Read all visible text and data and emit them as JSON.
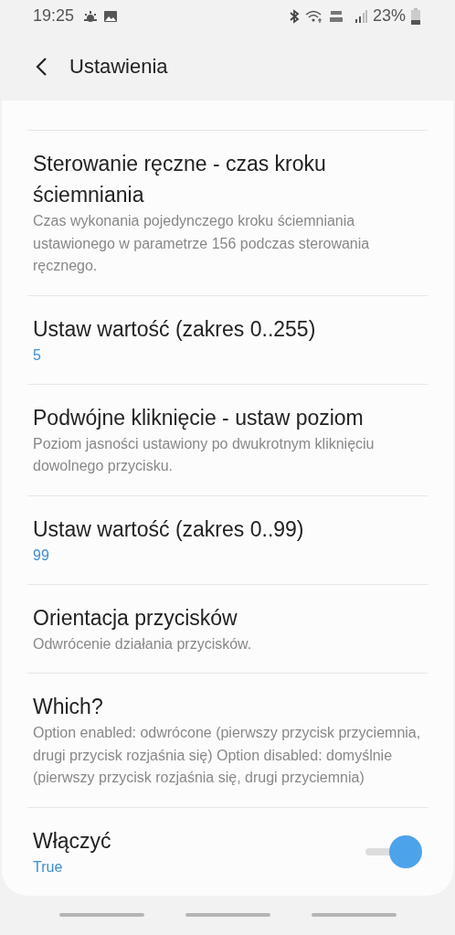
{
  "status_bar": {
    "time": "19:25",
    "battery": "23%"
  },
  "header": {
    "title": "Ustawienia"
  },
  "settings": [
    {
      "kind": "text",
      "title": "Sterowanie ręczne - czas kroku ściemniania",
      "summary": "Czas wykonania pojedynczego kroku ściemniania ustawionego w parametrze 156 podczas sterowania ręcznego."
    },
    {
      "kind": "value",
      "title": "Ustaw wartość (zakres 0..255)",
      "summary": "5"
    },
    {
      "kind": "text",
      "title": "Podwójne kliknięcie - ustaw poziom",
      "summary": "Poziom jasności ustawiony po dwukrotnym kliknięciu dowolnego przycisku."
    },
    {
      "kind": "value",
      "title": "Ustaw wartość (zakres 0..99)",
      "summary": "99"
    },
    {
      "kind": "text",
      "title": "Orientacja przycisków",
      "summary": "Odwrócenie działania przycisków."
    },
    {
      "kind": "text",
      "title": "Which?",
      "summary": "Option enabled: odwrócone (pierwszy przycisk przyciemnia, drugi przycisk rozjaśnia się) Option disabled: domyślnie (pierwszy przycisk rozjaśnia się, drugi przyciemnia)"
    },
    {
      "kind": "switch",
      "title": "Włączyć",
      "summary": "True",
      "on": true
    }
  ]
}
